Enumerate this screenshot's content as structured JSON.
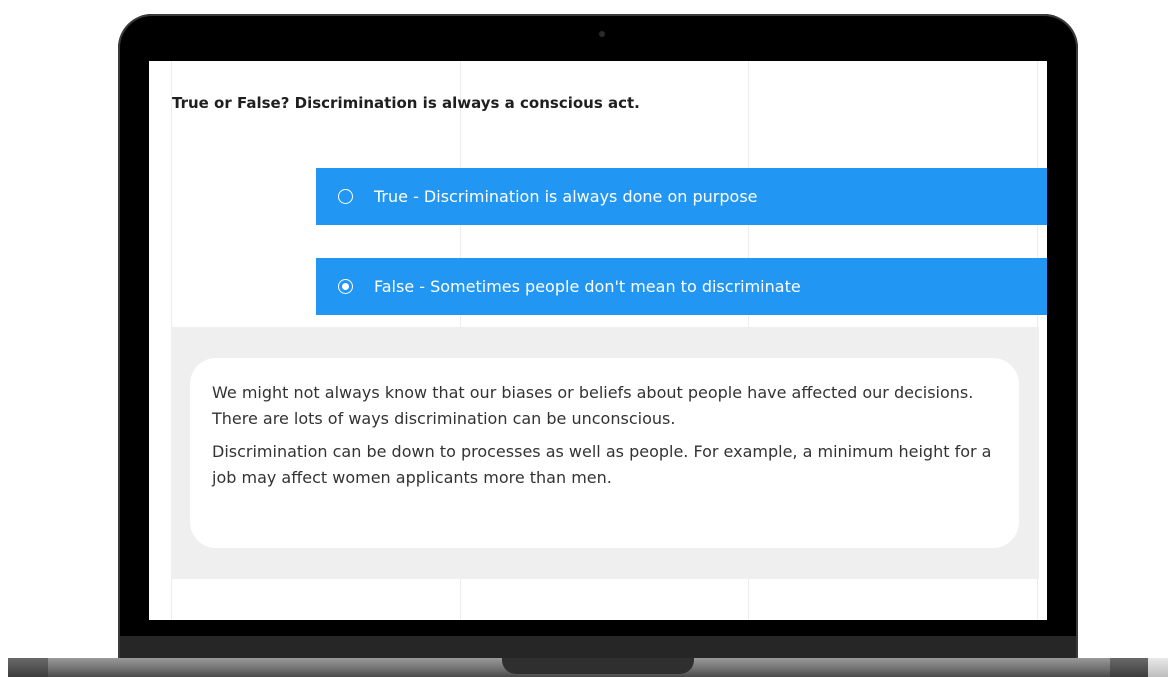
{
  "question": {
    "text": "True or False? Discrimination is always a conscious act."
  },
  "options": [
    {
      "label": "True - Discrimination is always done on purpose",
      "selected": false
    },
    {
      "label": "False - Sometimes people don't mean to discriminate",
      "selected": true
    }
  ],
  "feedback": {
    "paragraphs": [
      "We might not always know that our biases or beliefs about people have affected our decisions. There are lots of ways discrimination can be unconscious.",
      "Discrimination can be down to processes as well as people. For example, a minimum height for a job may affect women applicants more than men."
    ]
  },
  "colors": {
    "option_bg": "#2196f3",
    "feedback_bg": "#efefef"
  }
}
